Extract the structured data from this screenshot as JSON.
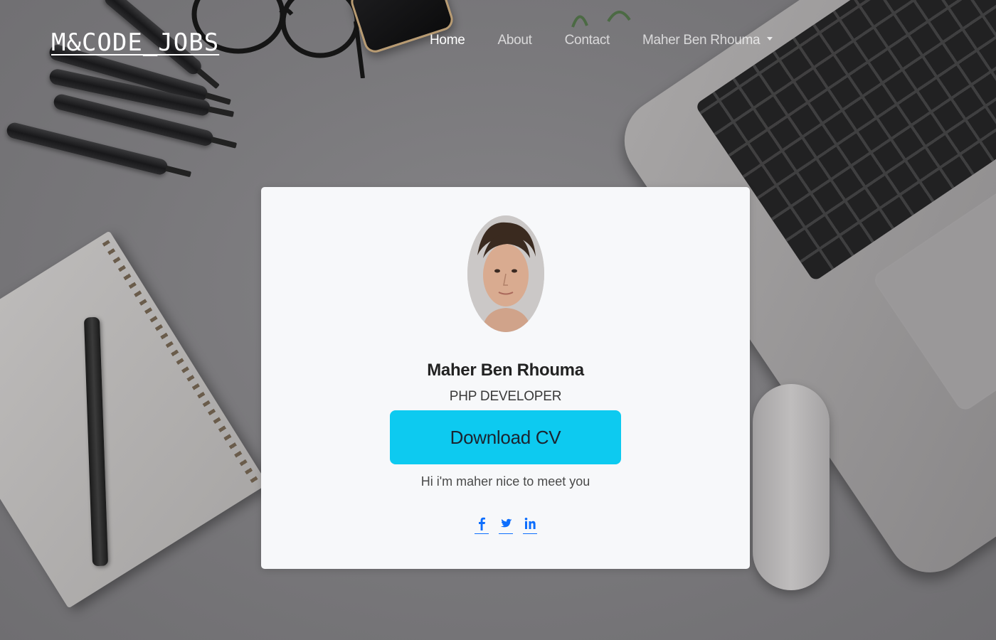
{
  "navbar": {
    "brand": "M&CODE_JOBS",
    "links": [
      {
        "label": "Home",
        "active": true
      },
      {
        "label": "About",
        "active": false
      },
      {
        "label": "Contact",
        "active": false
      }
    ],
    "user_menu": {
      "label": "Maher Ben Rhouma"
    }
  },
  "profile": {
    "name": "Maher Ben Rhouma",
    "role": "PHP DEVELOPER",
    "download_label": "Download CV",
    "greeting": "Hi i'm maher nice to meet you",
    "socials": [
      {
        "icon": "facebook-icon"
      },
      {
        "icon": "twitter-icon"
      },
      {
        "icon": "linkedin-icon"
      }
    ]
  },
  "colors": {
    "accent_button": "#0dcaf0",
    "link": "#0d6efd",
    "card_bg": "#f7f8fa"
  }
}
